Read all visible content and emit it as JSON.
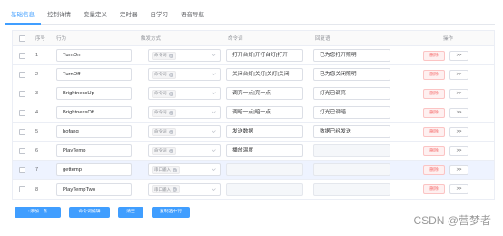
{
  "tabs": [
    "基础信息",
    "控制详情",
    "变量定义",
    "定时器",
    "自学习",
    "语音导航"
  ],
  "active_tab": 0,
  "columns": {
    "index": "序号",
    "action": "行为",
    "trigger": "触发方式",
    "command": "命令词",
    "reply": "回复语",
    "operation": "操作"
  },
  "rows": [
    {
      "index": "1",
      "action": "TurnOn",
      "trigger": "命令词",
      "command": "打开台灯|开打台灯|打开",
      "reply": "已为您打开照明"
    },
    {
      "index": "2",
      "action": "TurnOff",
      "trigger": "命令词",
      "command": "关闭台灯|关灯|关灯|关闭",
      "reply": "已为您关闭照明"
    },
    {
      "index": "3",
      "action": "BrightnessUp",
      "trigger": "命令词",
      "command": "调亮一点|亮一点",
      "reply": "灯光已调亮"
    },
    {
      "index": "4",
      "action": "BrightnessOff",
      "trigger": "命令词",
      "command": "调暗一点|暗一点",
      "reply": "灯光已调暗"
    },
    {
      "index": "5",
      "action": "bofang",
      "trigger": "命令词",
      "command": "发送数据",
      "reply": "数据已经发送"
    },
    {
      "index": "6",
      "action": "PlayTemp",
      "trigger": "命令词",
      "command": "播放温度",
      "reply": ""
    },
    {
      "index": "7",
      "action": "gettemp",
      "trigger": "串口输入",
      "command": "",
      "reply": ""
    },
    {
      "index": "8",
      "action": "PlayTempTwo",
      "trigger": "串口输入",
      "command": "",
      "reply": ""
    }
  ],
  "row_buttons": {
    "delete": "删除",
    "more": ">>"
  },
  "bottom_buttons": [
    "+添加一条",
    "命令词编辑",
    "清空",
    "复制选中行"
  ],
  "watermark": "CSDN @营梦者",
  "colors": {
    "accent": "#409eff",
    "danger": "#f56c6c",
    "selected_row": "#eef3ff"
  }
}
